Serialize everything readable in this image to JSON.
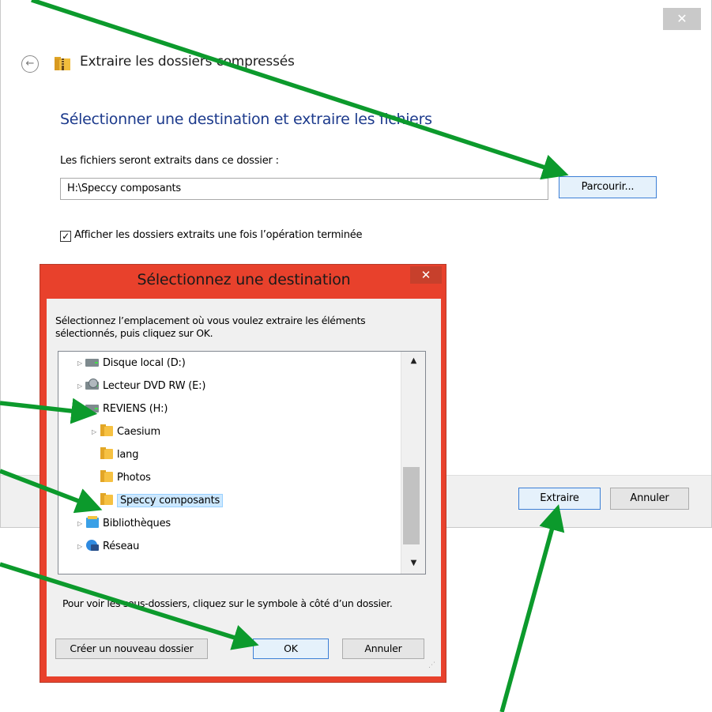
{
  "wizard": {
    "close_glyph": "✕",
    "back_glyph": "←",
    "title": "Extraire les dossiers compressés",
    "heading": "Sélectionner une destination et extraire les fichiers",
    "path_label": "Les fichiers seront extraits dans ce dossier :",
    "path_value": "H:\\Speccy composants",
    "browse_label": "Parcourir...",
    "show_folders_label": "Afficher les dossiers extraits une fois l’opération terminée",
    "show_folders_checked": true,
    "check_glyph": "✓",
    "extract_label": "Extraire",
    "cancel_label": "Annuler"
  },
  "dialog": {
    "title": "Sélectionnez une destination",
    "close_glyph": "✕",
    "description": "Sélectionnez l’emplacement où vous voulez extraire les éléments sélectionnés, puis cliquez sur OK.",
    "tree": [
      {
        "label": "Disque local (D:)",
        "icon": "drive-icon",
        "expandable": true
      },
      {
        "label": "Lecteur DVD RW (E:)",
        "icon": "dvd-drive-icon",
        "expandable": true
      },
      {
        "label": "REVIENS (H:)",
        "icon": "usb-drive-icon",
        "expandable": false
      },
      {
        "label": "Caesium",
        "icon": "folder-icon",
        "expandable": true
      },
      {
        "label": "lang",
        "icon": "folder-icon",
        "expandable": false
      },
      {
        "label": "Photos",
        "icon": "folder-icon",
        "expandable": false
      },
      {
        "label": "Speccy composants",
        "icon": "folder-icon",
        "expandable": false,
        "selected": true
      },
      {
        "label": "Bibliothèques",
        "icon": "libraries-icon",
        "expandable": true
      },
      {
        "label": "Réseau",
        "icon": "network-icon",
        "expandable": true
      }
    ],
    "expand_glyph": "▷",
    "scroll_up_glyph": "▲",
    "scroll_down_glyph": "▼",
    "hint": "Pour voir les sous-dossiers, cliquez sur le symbole à côté d’un dossier.",
    "new_folder_label": "Créer un nouveau dossier",
    "ok_label": "OK",
    "cancel_label": "Annuler",
    "grip_glyph": "⋰"
  },
  "colors": {
    "dialog_frame": "#e8412c",
    "heading_blue": "#1c3a8c",
    "annotation_arrow": "#0c9a2c",
    "selection": "#cce8ff"
  }
}
